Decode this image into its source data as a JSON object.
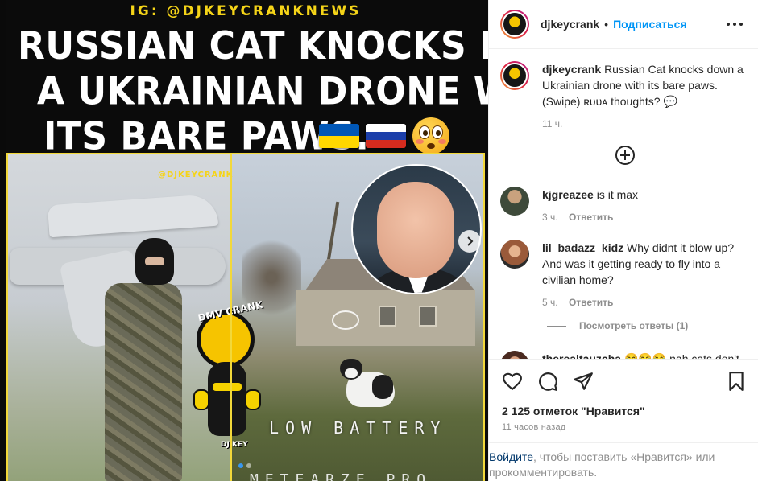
{
  "media": {
    "ig_handle": "IG: @DJKEYCRANKNEWS",
    "headline_lines": [
      "RUSSIAN CAT KNOCKS DOWN",
      "A UKRAINIAN DRONE WITH",
      "ITS BARE PAWS."
    ],
    "watermark": "@DJKEYCRANK",
    "logo_text": "DMV CRANK",
    "logo_sub": "DJ KEY",
    "overlay_text": "LOW BATTERY",
    "bottom_text": "METEARZE PRO",
    "flags": [
      "ukraine-flag",
      "russia-flag"
    ],
    "emoji": "flushed-face",
    "carousel": {
      "count": 2,
      "active": 1
    }
  },
  "header": {
    "username": "djkeycrank",
    "separator": "•",
    "follow_label": "Подписаться"
  },
  "caption": {
    "username": "djkeycrank",
    "text": "Russian Cat knocks down a Ukrainian drone with its bare paws. (Swipe) ʀᴜᴜᴀ thoughts? 💬",
    "time": "11 ч."
  },
  "comments": [
    {
      "username": "kjgreazee",
      "text": "is it max",
      "time": "3 ч.",
      "reply_label": "Ответить"
    },
    {
      "username": "lil_badazz_kidz",
      "text": "Why didnt it blow up? And was it getting ready to fly into a civilian home?",
      "time": "5 ч.",
      "reply_label": "Ответить"
    },
    {
      "username": "therealtauzcha",
      "text": "😂😂😂 nah cats don't",
      "time": "",
      "reply_label": ""
    }
  ],
  "view_replies_label": "Посмотреть ответы (1)",
  "actions": {
    "likes": "2 125 отметок \"Нравится\"",
    "time_ago": "11 часов назад"
  },
  "login_prompt": {
    "link": "Войдите",
    "text": ", чтобы поставить «Нравится» или прокомментировать."
  },
  "colors": {
    "accent_blue": "#0095f6",
    "headline_yellow": "#f5d418",
    "frame_yellow": "#f2d83a",
    "muted_text": "#8e8e8e"
  }
}
